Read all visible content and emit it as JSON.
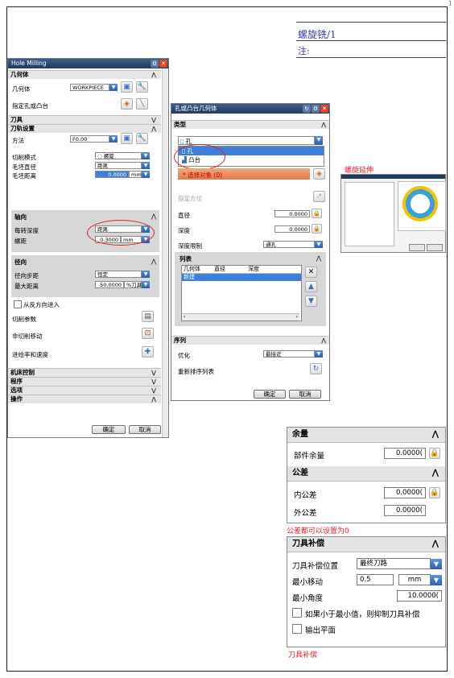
{
  "page": {
    "number": "1"
  },
  "doc": {
    "title": "螺旋铣/1",
    "note": "注:"
  },
  "captions": {
    "spiral_extend": "螺旋延伸",
    "tolerance_note": "公差都可以设置为0",
    "tool_comp": "刀具补偿"
  },
  "hole_milling": {
    "title": "Hole Milling",
    "geometry_section": "几何体",
    "geometry_label": "几何体",
    "geometry_value": "WORKPIECE_",
    "specify_holes_label": "指定孔或凸台",
    "tool_section": "刀具",
    "path_settings_section": "刀轨设置",
    "method_label": "方法",
    "method_value": "F0.00",
    "cut_mode_label": "切削模式",
    "cut_mode_value": "螺旋",
    "blank_diameter_label": "毛坯直径",
    "blank_diameter_value": "距离",
    "blank_distance_label": "毛坯距离",
    "blank_distance_value": "0.0000",
    "blank_distance_unit": "mm",
    "axial_section": "轴向",
    "depth_per_rev_label": "每转深度",
    "depth_per_rev_value": "距离",
    "pitch_label": "螺距",
    "pitch_value": "0.3000",
    "pitch_unit": "mm",
    "radial_section": "径向",
    "radial_step_label": "径向步距",
    "radial_step_value": "恒定",
    "max_distance_label": "最大距离",
    "max_distance_value": "50.0000",
    "max_distance_unit": "%刀具",
    "reverse_entry_label": "从反方向进入",
    "cut_params_label": "切削参数",
    "non_cut_moves_label": "非切削移动",
    "feeds_speeds_label": "进给率和速度",
    "machine_control_section": "机床控制",
    "program_section": "程序",
    "options_section": "选项",
    "actions_section": "操作",
    "ok_label": "确定",
    "cancel_label": "取消"
  },
  "hole_boss": {
    "title": "孔或凸台几何体",
    "type_section": "类型",
    "type_value": "孔",
    "type_option_hole": "孔",
    "type_option_boss": "凸台",
    "select_objects_label": "* 选择对象 (0)",
    "specify_orientation_label": "指定方位",
    "diameter_label": "直径",
    "diameter_value": "0.0000",
    "depth_label": "深度",
    "depth_value": "0.0000",
    "depth_limit_label": "深度限制",
    "depth_limit_value": "通孔",
    "list_section": "列表",
    "list_columns": [
      "几何体",
      "直径",
      "深度"
    ],
    "list_new_row": "新建",
    "sequence_section": "序列",
    "optimize_label": "优化",
    "optimize_value": "最接近",
    "reorder_label": "重新排序列表",
    "ok_label": "确定",
    "cancel_label": "取消"
  },
  "stock_panel": {
    "stock_section": "余量",
    "part_stock_label": "部件余量",
    "part_stock_value": "0.0000(",
    "tolerance_section": "公差",
    "intol_label": "内公差",
    "intol_value": "0.0000(",
    "outtol_label": "外公差",
    "outtol_value": "0.0000("
  },
  "tool_comp_panel": {
    "section": "刀具补偿",
    "position_label": "刀具补偿位置",
    "position_value": "最终刀路",
    "min_move_label": "最小移动",
    "min_move_value": "0.5",
    "min_move_unit": "mm",
    "min_angle_label": "最小角度",
    "min_angle_value": "10.0000(",
    "suppress_label": "如果小于最小值，则抑制刀具补偿",
    "output_plane_label": "输出平面"
  },
  "colors": {
    "titlebar": "#203a62",
    "annotation_red": "#e2222a",
    "doc_blue": "#3a3aa8",
    "dropdown_blue": "#2a5fb0",
    "selection_blue": "#3d7fd9"
  }
}
